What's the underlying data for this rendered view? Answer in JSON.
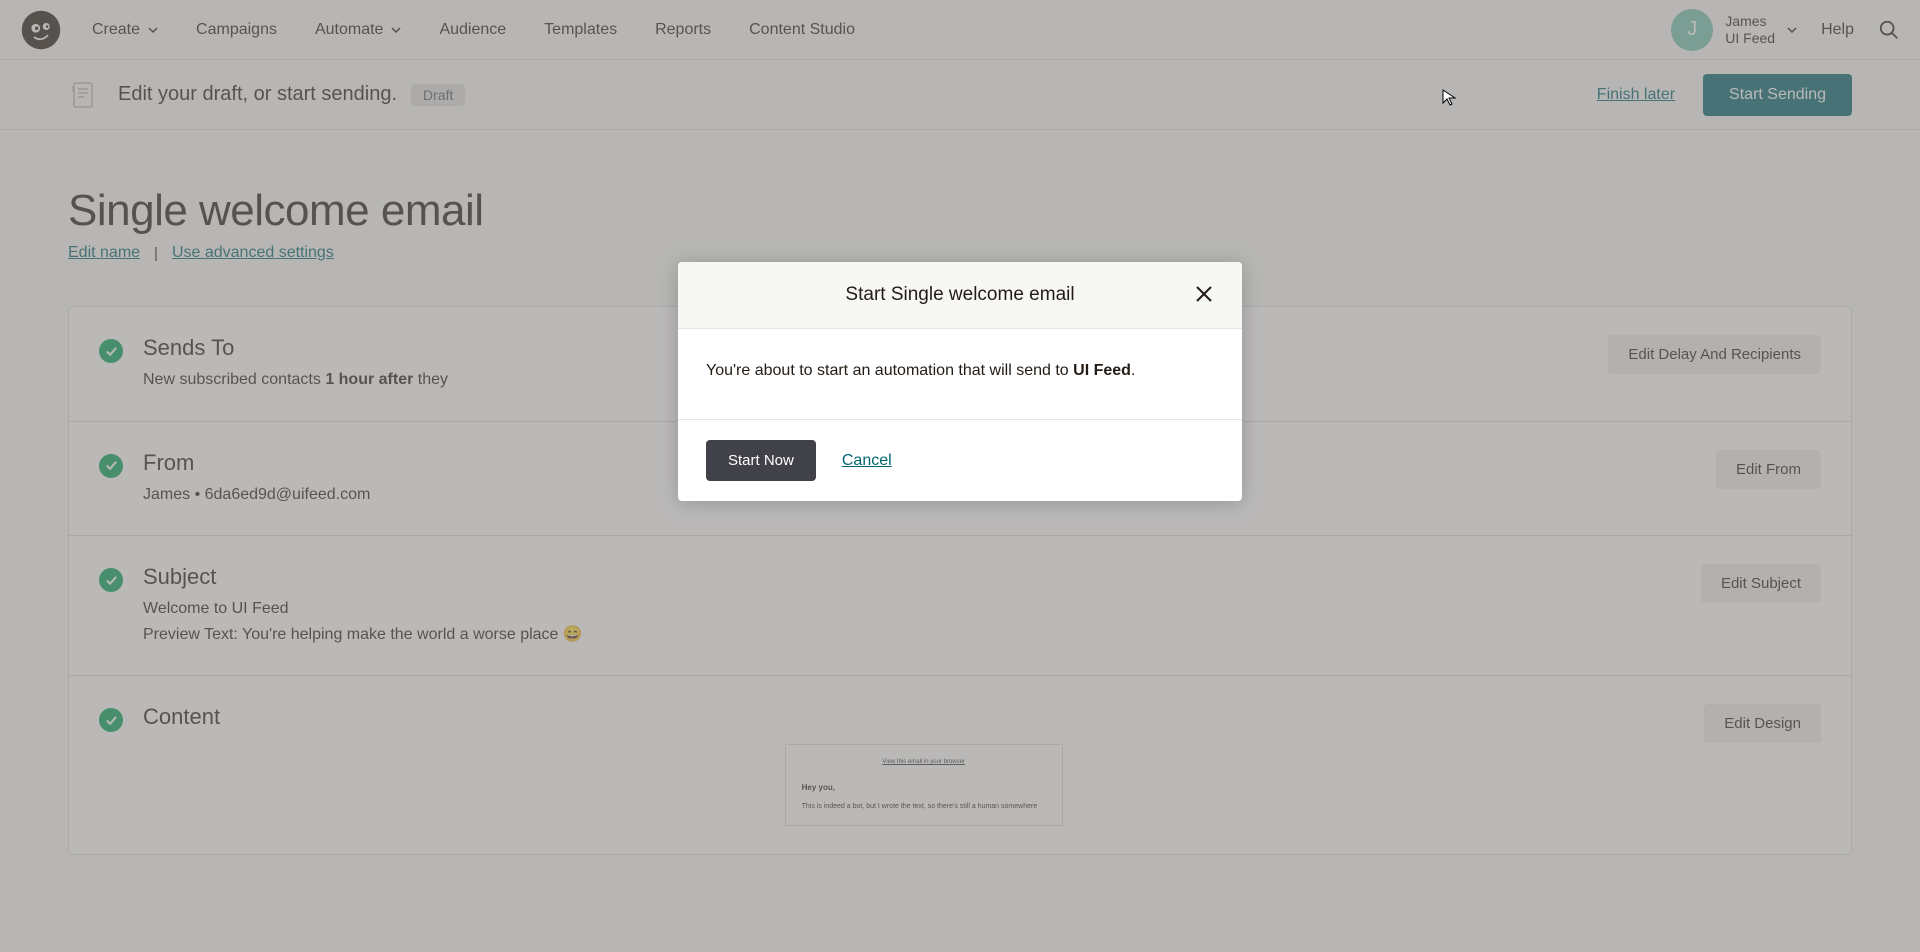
{
  "nav": {
    "items": [
      "Create",
      "Campaigns",
      "Automate",
      "Audience",
      "Templates",
      "Reports",
      "Content Studio"
    ],
    "account_name": "James",
    "account_sub": "UI Feed",
    "account_initial": "J",
    "help": "Help"
  },
  "action_bar": {
    "title": "Edit your draft, or start sending.",
    "badge": "Draft",
    "finish_link": "Finish later",
    "primary_btn": "Start Sending"
  },
  "page": {
    "title": "Single welcome email",
    "edit_name": "Edit name",
    "advanced": "Use advanced settings"
  },
  "cards": {
    "sends_to": {
      "title": "Sends To",
      "desc_prefix": "New subscribed contacts ",
      "desc_bold": "1 hour after",
      "desc_suffix": " they",
      "button": "Edit Delay And Recipients"
    },
    "from": {
      "title": "From",
      "desc": "James • 6da6ed9d@uifeed.com",
      "button": "Edit From"
    },
    "subject": {
      "title": "Subject",
      "line1": "Welcome to UI Feed",
      "line2": "Preview Text: You're helping make the world a worse place 😄",
      "button": "Edit Subject"
    },
    "content": {
      "title": "Content",
      "button": "Edit Design",
      "preview_toplink": "View this email in your browser",
      "preview_greeting": "Hey you,",
      "preview_text": "This is indeed a bot, but I wrote the text, so there's still a human somewhere"
    }
  },
  "modal": {
    "title": "Start Single welcome email",
    "body_prefix": "You're about to start an automation that will send to ",
    "body_bold": "UI Feed",
    "body_suffix": ".",
    "start_btn": "Start Now",
    "cancel": "Cancel"
  }
}
